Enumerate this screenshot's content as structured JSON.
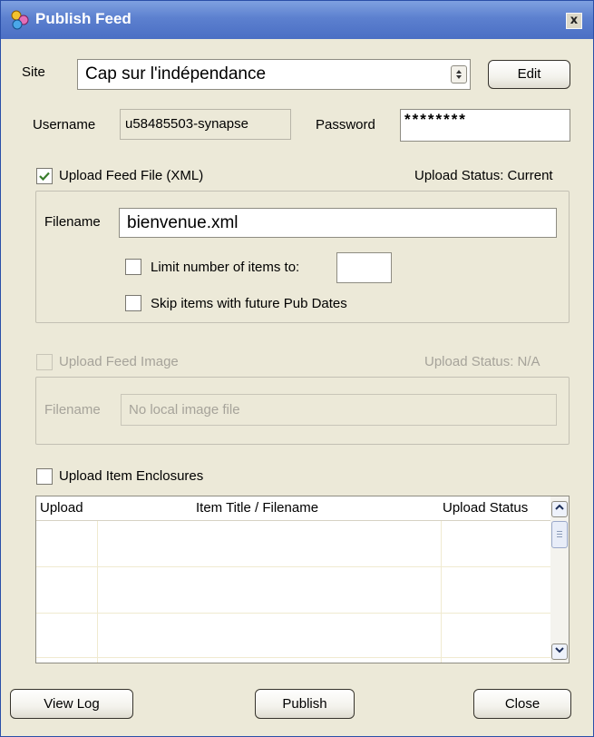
{
  "window": {
    "title": "Publish Feed",
    "close_glyph": "x"
  },
  "site": {
    "label": "Site",
    "value": "Cap sur l'indépendance",
    "edit_label": "Edit"
  },
  "credentials": {
    "username_label": "Username",
    "username_value": "u58485503-synapse",
    "password_label": "Password",
    "password_value": "********"
  },
  "feed_file": {
    "checkbox_label": "Upload Feed File (XML)",
    "checked": true,
    "status": "Upload Status: Current",
    "filename_label": "Filename",
    "filename_value": "bienvenue.xml",
    "limit_label": "Limit number of items to:",
    "limit_value": "",
    "skip_label": "Skip items with future Pub Dates"
  },
  "feed_image": {
    "checkbox_label": "Upload Feed Image",
    "status": "Upload Status: N/A",
    "filename_label": "Filename",
    "filename_placeholder": "No local image file"
  },
  "enclosures": {
    "checkbox_label": "Upload Item Enclosures",
    "columns": [
      "Upload",
      "Item Title / Filename",
      "Upload Status"
    ]
  },
  "buttons": {
    "view_log": "View Log",
    "publish": "Publish",
    "close": "Close"
  },
  "colors": {
    "titlebar": "#5c80cf",
    "window_bg": "#ece9d8",
    "check": "#3a7d2c"
  }
}
